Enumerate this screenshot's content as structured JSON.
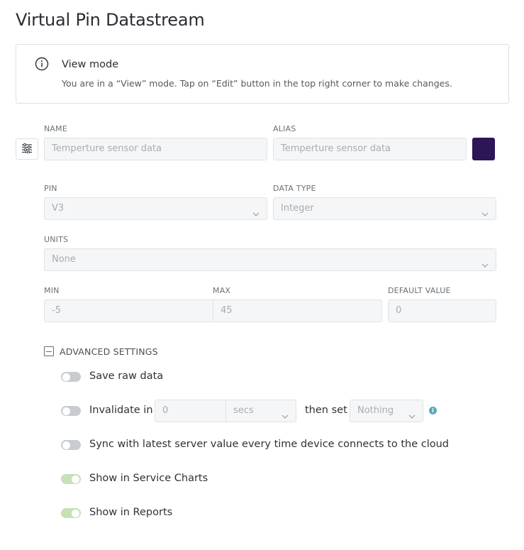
{
  "page": {
    "title": "Virtual Pin Datastream"
  },
  "notice": {
    "icon": "info-circle-icon",
    "title": "View mode",
    "text": "You are in a “View” mode. Tap on “Edit” button in the top right corner to make changes."
  },
  "form": {
    "sort_icon": "sliders-icon",
    "name": {
      "label": "NAME",
      "placeholder": "Temperture sensor data"
    },
    "alias": {
      "label": "ALIAS",
      "placeholder": "Temperture sensor data"
    },
    "color": {
      "value": "#2c1656"
    },
    "pin": {
      "label": "PIN",
      "value": "V3"
    },
    "data_type": {
      "label": "DATA TYPE",
      "value": "Integer"
    },
    "units": {
      "label": "UNITS",
      "value": "None"
    },
    "min": {
      "label": "MIN",
      "value": "-5"
    },
    "max": {
      "label": "MAX",
      "value": "45"
    },
    "default_value": {
      "label": "DEFAULT VALUE",
      "value": "0"
    }
  },
  "advanced": {
    "label": "ADVANCED SETTINGS",
    "expanded": true,
    "save_raw": {
      "label": "Save raw data",
      "on": false
    },
    "invalidate": {
      "label": "Invalidate in",
      "on": false,
      "amount": "0",
      "unit": "secs",
      "then_label": "then set",
      "then_value": "Nothing",
      "info_icon": "info-icon"
    },
    "sync": {
      "label": "Sync with latest server value every time device connects to the cloud",
      "on": false
    },
    "service_charts": {
      "label": "Show in Service Charts",
      "on": true
    },
    "reports": {
      "label": "Show in Reports",
      "on": true
    }
  },
  "colors": {
    "toggle_off": "#c8ccd0",
    "toggle_on": "#c5e1b7",
    "field_bg": "#f5f6f7",
    "info_accent": "#5aa9b8"
  }
}
